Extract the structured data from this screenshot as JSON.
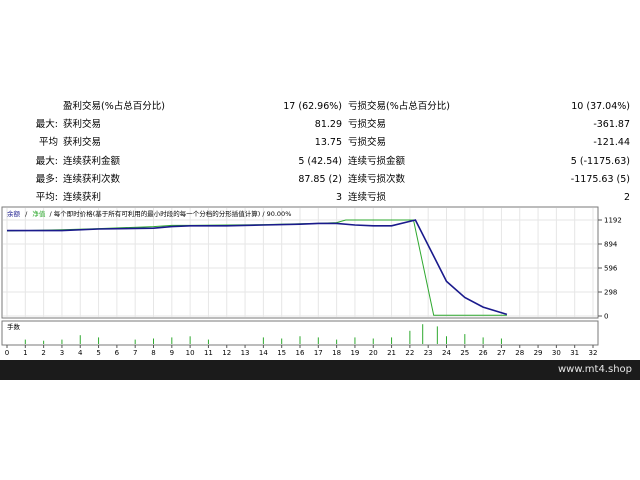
{
  "stats": {
    "rows": [
      {
        "prefix": "",
        "name1": "盈利交易(%占总百分比)",
        "val1": "17 (62.96%)",
        "name2": "亏损交易(%占总百分比)",
        "val2": "10 (37.04%)"
      },
      {
        "prefix": "最大:",
        "name1": "获利交易",
        "val1": "81.29",
        "name2": "亏损交易",
        "val2": "-361.87"
      },
      {
        "prefix": "平均",
        "name1": "获利交易",
        "val1": "13.75",
        "name2": "亏损交易",
        "val2": "-121.44"
      },
      {
        "prefix": "最大:",
        "name1": "连续获利金额",
        "val1": "5 (42.54)",
        "name2": "连续亏损金额",
        "val2": "5 (-1175.63)"
      },
      {
        "prefix": "最多:",
        "name1": "连续获利次数",
        "val1": "87.85 (2)",
        "name2": "连续亏损次数",
        "val2": "-1175.63 (5)"
      },
      {
        "prefix": "平均:",
        "name1": "连续获利",
        "val1": "3",
        "name2": "连续亏损",
        "val2": "2"
      }
    ]
  },
  "chart": {
    "legend_balance": "余额",
    "legend_sep1": "/",
    "legend_equity": "净值",
    "legend_rest": "/ 每个即时价格(基于所有可利用的最小时段的每一个分档的分形插值计算) / 90.00%",
    "volume_label": "手数",
    "colors": {
      "balance": "#1a1a8c",
      "equity": "#2ea82e",
      "volume": "#2ea82e",
      "grid": "#e6e6e6",
      "border": "#7a7a7a"
    }
  },
  "chart_data": {
    "type": "line",
    "x_ticks": [
      0,
      1,
      2,
      3,
      4,
      5,
      6,
      7,
      8,
      9,
      10,
      11,
      12,
      13,
      14,
      15,
      16,
      17,
      18,
      19,
      20,
      21,
      22,
      23,
      24,
      25,
      26,
      27,
      28,
      29,
      30,
      31,
      32
    ],
    "y_ticks": [
      "1192",
      "894",
      "596",
      "298",
      "0"
    ],
    "ylim": [
      0,
      1192
    ],
    "xlim": [
      0,
      32
    ],
    "series": [
      {
        "name": "余额",
        "x": [
          0,
          3,
          5,
          8,
          9,
          10,
          12,
          14,
          16,
          17,
          18,
          19,
          20,
          21,
          22.3,
          24,
          25,
          26,
          27.3
        ],
        "y": [
          1060,
          1060,
          1080,
          1090,
          1110,
          1120,
          1120,
          1130,
          1140,
          1150,
          1150,
          1130,
          1120,
          1120,
          1192,
          430,
          230,
          110,
          20
        ]
      },
      {
        "name": "净值",
        "x": [
          0,
          3,
          5,
          8,
          9,
          10,
          12,
          14,
          16,
          17,
          18,
          18.5,
          20,
          21,
          22.2,
          23.3,
          24,
          25,
          26,
          27.3
        ],
        "y": [
          1055,
          1070,
          1085,
          1110,
          1125,
          1125,
          1130,
          1135,
          1145,
          1150,
          1160,
          1192,
          1192,
          1192,
          1192,
          10,
          10,
          10,
          10,
          10
        ]
      }
    ],
    "volume": {
      "x": [
        1,
        2,
        3,
        4,
        5,
        7,
        8,
        9,
        10,
        11,
        14,
        15,
        16,
        17,
        18,
        19,
        20,
        21,
        22,
        22.7,
        23.5,
        24,
        25,
        26,
        27
      ],
      "h": [
        0.2,
        0.15,
        0.2,
        0.4,
        0.3,
        0.2,
        0.25,
        0.3,
        0.35,
        0.2,
        0.3,
        0.25,
        0.35,
        0.3,
        0.2,
        0.3,
        0.25,
        0.3,
        0.6,
        0.9,
        0.8,
        0.35,
        0.45,
        0.3,
        0.25
      ]
    }
  },
  "footer": {
    "site": "www.mt4.shop"
  }
}
